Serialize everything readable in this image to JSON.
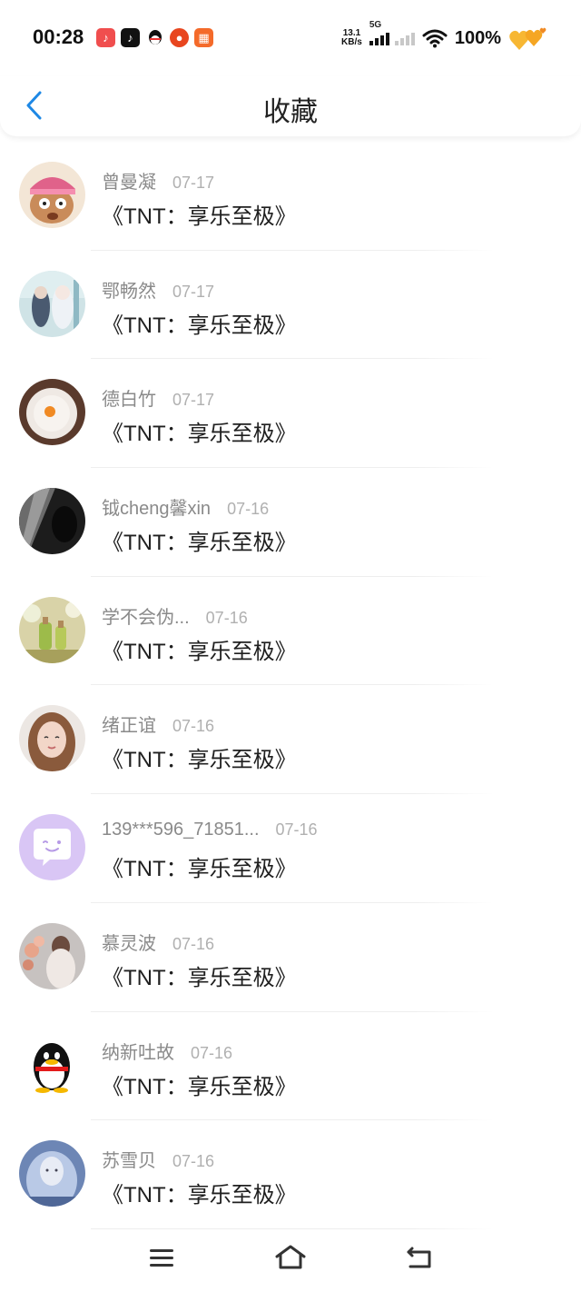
{
  "status_bar": {
    "time": "00:28",
    "net_speed_value": "13.1",
    "net_speed_unit": "KB/s",
    "network_type": "5G",
    "battery": "100%",
    "app_icons": [
      "music-app-icon",
      "tiktok-icon",
      "qq-icon",
      "taobao-icon",
      "app-store-icon"
    ]
  },
  "header": {
    "title": "收藏"
  },
  "items": [
    {
      "name": "曾曼凝",
      "date": "07-17",
      "title": "《TNT：享乐至极》",
      "avatar": "cartoon-avatar"
    },
    {
      "name": "鄂畅然",
      "date": "07-17",
      "title": "《TNT：享乐至极》",
      "avatar": "anime-avatar"
    },
    {
      "name": "德白竹",
      "date": "07-17",
      "title": "《TNT：享乐至极》",
      "avatar": "egg-avatar"
    },
    {
      "name": "钺cheng馨xin",
      "date": "07-16",
      "title": "《TNT：享乐至极》",
      "avatar": "shadow-avatar"
    },
    {
      "name": "学不会伪...",
      "date": "07-16",
      "title": "《TNT：享乐至极》",
      "avatar": "bottles-avatar"
    },
    {
      "name": "绪正谊",
      "date": "07-16",
      "title": "《TNT：享乐至极》",
      "avatar": "girl-avatar"
    },
    {
      "name": "139***596_71851...",
      "date": "07-16",
      "title": "《TNT：享乐至极》",
      "avatar": "default-chat-avatar"
    },
    {
      "name": "慕灵波",
      "date": "07-16",
      "title": "《TNT：享乐至极》",
      "avatar": "flowers-avatar"
    },
    {
      "name": "纳新吐故",
      "date": "07-16",
      "title": "《TNT：享乐至极》",
      "avatar": "penguin-avatar"
    },
    {
      "name": "苏雪贝",
      "date": "07-16",
      "title": "《TNT：享乐至极》",
      "avatar": "fantasy-avatar"
    }
  ],
  "colors": {
    "accent": "#1e88e5",
    "name_text": "#8a8a8a",
    "date_text": "#b0b0b0",
    "title_text": "#1f1f1f"
  }
}
